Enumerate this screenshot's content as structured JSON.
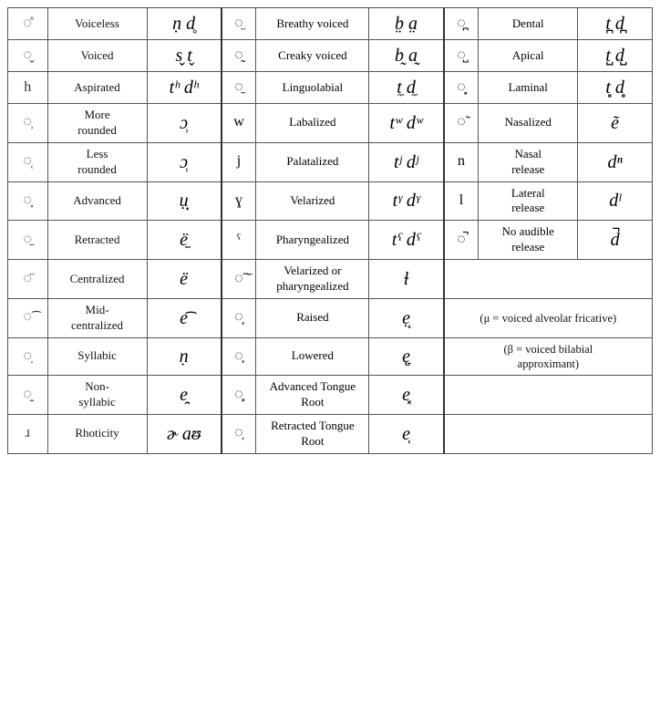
{
  "rows": [
    {
      "left": {
        "icon": "◌̊",
        "label": "Voiceless",
        "symbol": "ṇ d̥"
      },
      "mid": {
        "icon": "◌̤",
        "label": "Breathy voiced",
        "symbol": "b̤ a̤"
      },
      "right": {
        "icon": "◌̪",
        "label": "Dental",
        "symbol": "t̪ d̪"
      }
    },
    {
      "left": {
        "icon": "◌̬",
        "label": "Voiced",
        "symbol": "s̬ t̬"
      },
      "mid": {
        "icon": "◌̰",
        "label": "Creaky voiced",
        "symbol": "b̰ a̰"
      },
      "right": {
        "icon": "◌̺",
        "label": "Apical",
        "symbol": "t̺ d̺"
      }
    },
    {
      "left": {
        "icon": "h",
        "label": "Aspirated",
        "symbol": "tʰ dʰ"
      },
      "mid": {
        "icon": "◌̼",
        "label": "Linguolabial",
        "symbol": "t̼ d̼"
      },
      "right": {
        "icon": "◌̻",
        "label": "Laminal",
        "symbol": "t̻ d̻"
      }
    },
    {
      "left": {
        "icon": "◌̹",
        "label": "More\nrounded",
        "symbol": "ɔ̹"
      },
      "mid": {
        "icon": "w",
        "label": "Labalized",
        "symbol": "tʷ dʷ"
      },
      "right": {
        "icon": "◌̃",
        "label": "Nasalized",
        "symbol": "ẽ"
      }
    },
    {
      "left": {
        "icon": "◌̜",
        "label": "Less\nrounded",
        "symbol": "ɔ̜"
      },
      "mid": {
        "icon": "j",
        "label": "Palatalized",
        "symbol": "tʲ dʲ"
      },
      "right": {
        "icon": "n",
        "label": "Nasal\nrelease",
        "symbol": "dⁿ"
      }
    },
    {
      "left": {
        "icon": "◌̟",
        "label": "Advanced",
        "symbol": "ụ̟"
      },
      "mid": {
        "icon": "ɣ",
        "label": "Velarized",
        "symbol": "tᵞ dᵞ"
      },
      "right": {
        "icon": "l",
        "label": "Lateral\nrelease",
        "symbol": "dˡ"
      }
    },
    {
      "left": {
        "icon": "◌̠",
        "label": "Retracted",
        "symbol": "ë̠"
      },
      "mid": {
        "icon": "ˤ",
        "label": "Pharyngealized",
        "symbol": "tˤ dˤ"
      },
      "right": {
        "icon": "◌̚",
        "label": "No audible\nrelease",
        "symbol": "d̚"
      }
    },
    {
      "left": {
        "icon": "◌̈",
        "label": "Centralized",
        "symbol": "ë"
      },
      "mid": {
        "icon": "◌͠",
        "label": "Velarized or\npharyngealized",
        "symbol": "ɫ"
      },
      "right": {
        "icon": "",
        "label": "",
        "symbol": ""
      }
    },
    {
      "left": {
        "icon": "◌͡",
        "label": "Mid-\ncentralized",
        "symbol": "e͡"
      },
      "mid": {
        "icon": "◌̝",
        "label": "Raised",
        "symbol": "ẹ̝"
      },
      "right": {
        "icon": "",
        "label": "(μ = voiced alveolar fricative)",
        "symbol": ""
      }
    },
    {
      "left": {
        "icon": "◌̩",
        "label": "Syllabic",
        "symbol": "ṇ"
      },
      "mid": {
        "icon": "◌̞",
        "label": "Lowered",
        "symbol": "ę̞"
      },
      "right": {
        "icon": "",
        "label": "(β = voiced bilabial\napproximant)",
        "symbol": ""
      }
    },
    {
      "left": {
        "icon": "◌̯",
        "label": "Non-\nsyllabic",
        "symbol": "e̯"
      },
      "mid": {
        "icon": "◌͓",
        "label": "Advanced Tongue\nRoot",
        "symbol": "e͓"
      },
      "right": {
        "icon": "",
        "label": "",
        "symbol": ""
      }
    },
    {
      "left": {
        "icon": "ɹ",
        "label": "Rhoticity",
        "symbol": "ɚ aᵿ"
      },
      "mid": {
        "icon": "◌͔",
        "label": "Retracted Tongue\nRoot",
        "symbol": "e͔"
      },
      "right": {
        "icon": "",
        "label": "",
        "symbol": ""
      }
    }
  ]
}
